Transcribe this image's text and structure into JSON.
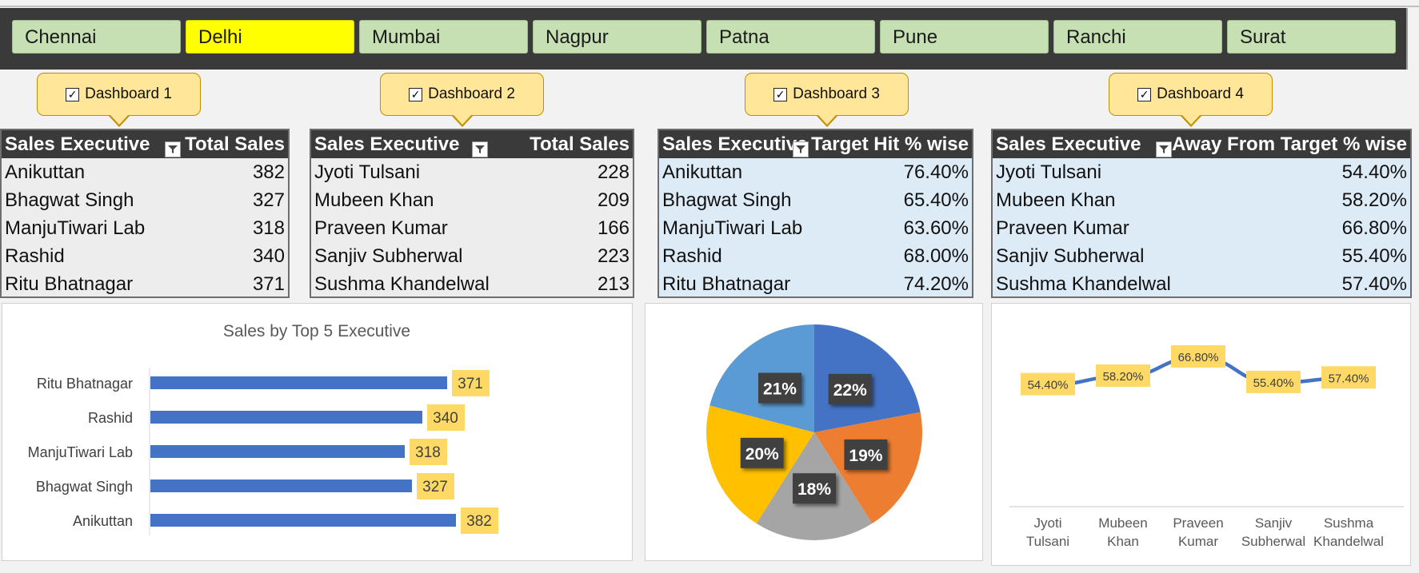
{
  "slicer": {
    "items": [
      "Chennai",
      "Delhi",
      "Mumbai",
      "Nagpur",
      "Patna",
      "Pune",
      "Ranchi",
      "Surat"
    ],
    "selected": "Delhi"
  },
  "callouts": [
    "Dashboard 1",
    "Dashboard 2",
    "Dashboard 3",
    "Dashboard 4"
  ],
  "tables": {
    "t1": {
      "col1": "Sales Executive",
      "col2": "Total Sales",
      "rows": [
        [
          "Anikuttan",
          "382"
        ],
        [
          "Bhagwat Singh",
          "327"
        ],
        [
          "ManjuTiwari Lab",
          "318"
        ],
        [
          "Rashid",
          "340"
        ],
        [
          "Ritu Bhatnagar",
          "371"
        ]
      ]
    },
    "t2": {
      "col1": "Sales Executive",
      "col2": "Total Sales",
      "rows": [
        [
          "Jyoti Tulsani",
          "228"
        ],
        [
          "Mubeen Khan",
          "209"
        ],
        [
          "Praveen Kumar",
          "166"
        ],
        [
          "Sanjiv Subherwal",
          "223"
        ],
        [
          "Sushma Khandelwal",
          "213"
        ]
      ]
    },
    "t3": {
      "col1": "Sales Executive",
      "col2": "Target Hit % wise",
      "rows": [
        [
          "Anikuttan",
          "76.40%"
        ],
        [
          "Bhagwat Singh",
          "65.40%"
        ],
        [
          "ManjuTiwari Lab",
          "63.60%"
        ],
        [
          "Rashid",
          "68.00%"
        ],
        [
          "Ritu Bhatnagar",
          "74.20%"
        ]
      ]
    },
    "t4": {
      "col1": "Sales Executive",
      "col2": "Away From Target % wise",
      "rows": [
        [
          "Jyoti Tulsani",
          "54.40%"
        ],
        [
          "Mubeen Khan",
          "58.20%"
        ],
        [
          "Praveen Kumar",
          "66.80%"
        ],
        [
          "Sanjiv Subherwal",
          "55.40%"
        ],
        [
          "Sushma Khandelwal",
          "57.40%"
        ]
      ]
    }
  },
  "colors": {
    "bar": "#4472c4",
    "label_bg": "#ffd966",
    "pie": [
      "#4472c4",
      "#ed7d31",
      "#a5a5a5",
      "#ffc000",
      "#5b9bd5"
    ],
    "line": "#4472c4"
  },
  "chart_data": [
    {
      "type": "bar",
      "title": "Sales by Top 5 Executive",
      "categories": [
        "Ritu Bhatnagar",
        "Rashid",
        "ManjuTiwari Lab",
        "Bhagwat Singh",
        "Anikuttan"
      ],
      "values": [
        371,
        340,
        318,
        327,
        382
      ],
      "orientation": "horizontal",
      "xlim": [
        0,
        440
      ]
    },
    {
      "type": "pie",
      "labels": [
        "22%",
        "19%",
        "18%",
        "20%",
        "21%"
      ],
      "values": [
        22,
        19,
        18,
        20,
        21
      ]
    },
    {
      "type": "line",
      "categories": [
        "Jyoti Tulsani",
        "Mubeen Khan",
        "Praveen Kumar",
        "Sanjiv Subherwal",
        "Sushma Khandelwal"
      ],
      "category_lines": [
        [
          "Jyoti",
          "Tulsani"
        ],
        [
          "Mubeen",
          "Khan"
        ],
        [
          "Praveen",
          "Kumar"
        ],
        [
          "Sanjiv",
          "Subherwal"
        ],
        [
          "Sushma",
          "Khandelwal"
        ]
      ],
      "values": [
        54.4,
        58.2,
        66.8,
        55.4,
        57.4
      ],
      "labels": [
        "54.40%",
        "58.20%",
        "66.80%",
        "55.40%",
        "57.40%"
      ],
      "ylim": [
        0,
        80
      ]
    }
  ]
}
